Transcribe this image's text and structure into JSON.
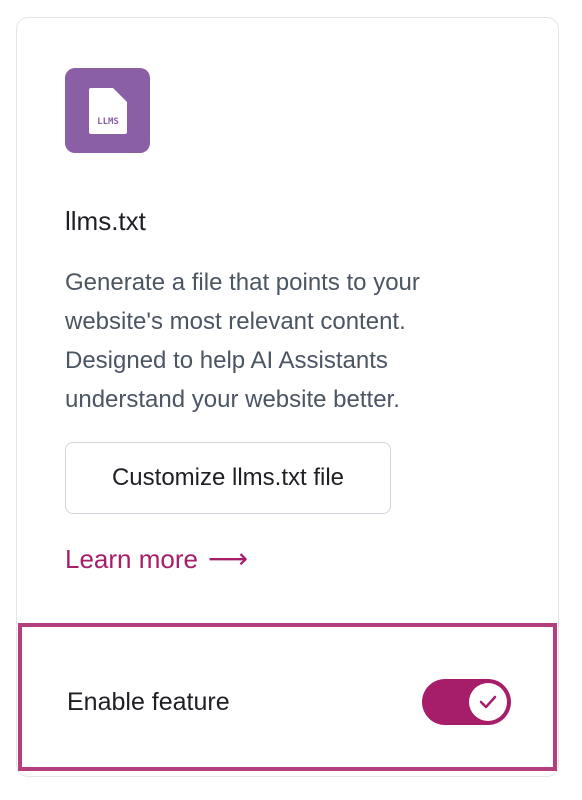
{
  "feature": {
    "icon": {
      "name": "llms-file-icon",
      "text": "LLMS",
      "background_color": "#8b5fa6"
    },
    "title": "llms.txt",
    "description": "Generate a file that points to your website's most relevant content. Designed to help AI Assistants understand your website better.",
    "customize_button_label": "Customize llms.txt file",
    "learn_more_label": "Learn more",
    "learn_more_arrow": "⟶"
  },
  "footer": {
    "enable_label": "Enable feature",
    "toggle_on": true,
    "accent_color": "#a61e69",
    "highlight_border_color": "#b53f7d"
  }
}
